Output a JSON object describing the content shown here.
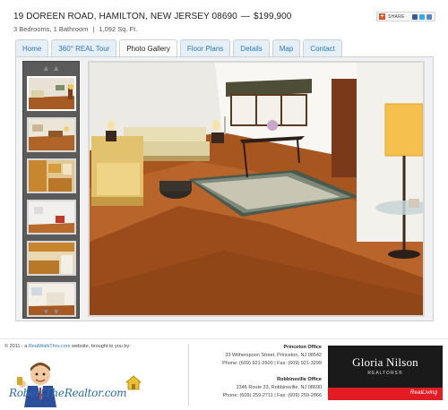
{
  "listing": {
    "address": "19 DOREEN ROAD, HAMILTON, NEW JERSEY 08690",
    "dash": "—",
    "price": "$199,900",
    "beds_baths": "3 Bedrooms, 1 Bathroom",
    "separator": "|",
    "area": "1,092 Sq. Ft."
  },
  "share": {
    "label": "SHARE",
    "plus": "+"
  },
  "tabs": [
    {
      "label": "Home"
    },
    {
      "label": "360° REAL Tour"
    },
    {
      "label": "Photo Gallery",
      "active": true
    },
    {
      "label": "Floor Plans"
    },
    {
      "label": "Details"
    },
    {
      "label": "Map"
    },
    {
      "label": "Contact"
    }
  ],
  "gallery": {
    "up_arrows": "▲ ▲",
    "down_arrows": "▼ ▼",
    "thumbnail_count": 6,
    "selected_index": 0
  },
  "footer": {
    "copyright_prefix": "© 2011 - a",
    "link_text": "RealWalkThru.com",
    "copyright_suffix": "website, brought to you by:",
    "brand_text": "RobertTheRealtor.com",
    "offices": [
      {
        "name": "Princeton Office",
        "address": "33 Witherspoon Street, Princeton, NJ 08542",
        "phones": "Phone: (609) 921-2600 | Fax: (609) 921-3299"
      },
      {
        "name": "Robbinsville Office",
        "address": "2346 Route 33, Robbinsville, NJ 08690",
        "phones": "Phone: (609) 259-2711 | Fax: (609) 259-2866"
      }
    ],
    "logo_name": "Gloria Nilson",
    "logo_sub": "REALTORS®",
    "logo_tag": "RealLiving"
  },
  "colors": {
    "accent": "#2a7ab8",
    "brand_red": "#e31b23",
    "logo_bg": "#1a1a1a"
  }
}
